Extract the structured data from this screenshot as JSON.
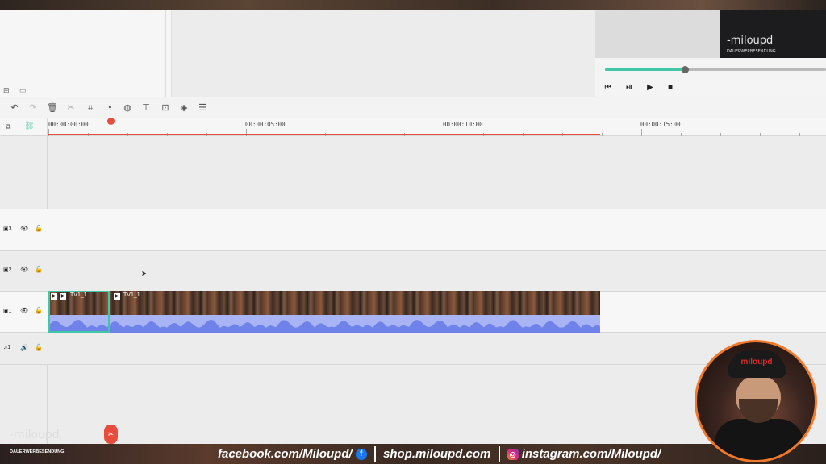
{
  "preview": {
    "logo_main": "-miloupd",
    "logo_sub": "DAUERWERBESENDUNG",
    "progress": 0.36,
    "controls": {
      "prev": "⏮",
      "step": "⏯",
      "play": "▶",
      "stop": "■"
    }
  },
  "media": {
    "icons": [
      "new-folder-icon",
      "folder-icon"
    ]
  },
  "toolbar": {
    "icons": [
      "undo-icon",
      "redo-icon",
      "delete-icon",
      "cut-icon",
      "crop-icon",
      "speed-icon",
      "color-icon",
      "audio-mixer-icon",
      "zoom-icon",
      "motion-icon",
      "adjust-icon"
    ]
  },
  "timeline": {
    "ruler": [
      "00:00:00:00",
      "00:00:05:00",
      "00:00:10:00",
      "00:00:15:00"
    ],
    "tracks": [
      {
        "label": "3",
        "type": "video"
      },
      {
        "label": "2",
        "type": "video"
      },
      {
        "label": "1",
        "type": "video"
      },
      {
        "label": "1",
        "type": "audio"
      }
    ],
    "clips": [
      {
        "label": "TV1_1"
      },
      {
        "label": "TV1_1"
      }
    ]
  },
  "webcam": {
    "cap_text": "miloupd"
  },
  "footer": {
    "facebook": "facebook.com/Miloupd/",
    "shop": "shop.miloupd.com",
    "instagram": "instagram.com/Miloupd/",
    "watermark": "-miloupd",
    "watermark_sub": "DAUERWERBESENDUNG"
  },
  "colors": {
    "accent": "#3fc7a6",
    "playhead": "#e74c3c",
    "audio": "#a8b4f4"
  }
}
